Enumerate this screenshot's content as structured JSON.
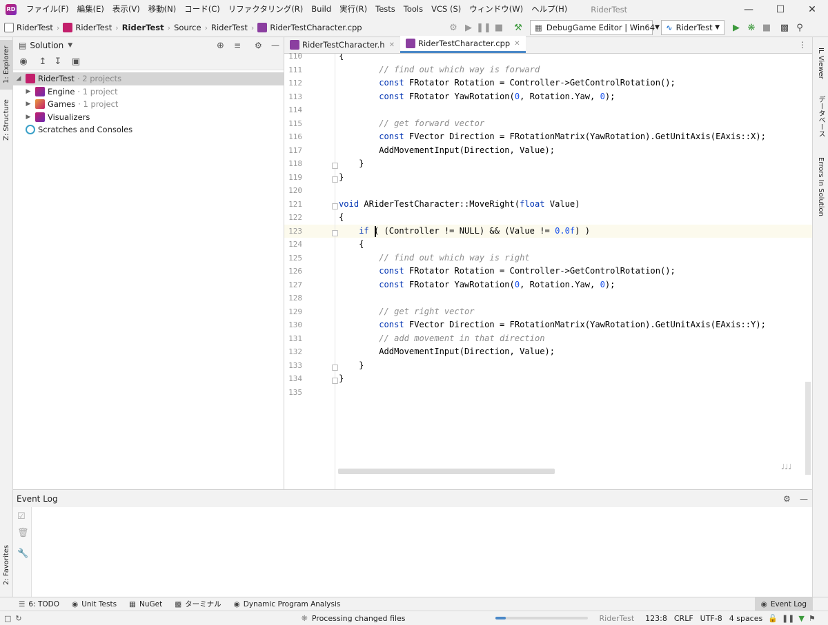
{
  "menu": {
    "items": [
      "ファイル(F)",
      "編集(E)",
      "表示(V)",
      "移動(N)",
      "コード(C)",
      "リファクタリング(R)",
      "Build",
      "実行(R)",
      "Tests",
      "Tools",
      "VCS (S)",
      "ウィンドウ(W)",
      "ヘルプ(H)"
    ],
    "app_title": "RiderTest"
  },
  "breadcrumb": {
    "items": [
      "RiderTest",
      "RiderTest",
      "RiderTest",
      "Source",
      "RiderTest",
      "RiderTestCharacter.cpp"
    ]
  },
  "toolbar": {
    "config": "DebugGame Editor | Win64",
    "project": "RiderTest"
  },
  "left_tools": {
    "explorer": "1: Explorer",
    "structure": "Z: Structure",
    "favorites": "2: Favorites"
  },
  "right_tools": {
    "il_viewer": "IL Viewer",
    "database": "データベース",
    "errors": "Errors In Solution"
  },
  "solution": {
    "title": "Solution",
    "tree": [
      {
        "label": "RiderTest",
        "note": "· 2 projects"
      },
      {
        "label": "Engine",
        "note": "· 1 project"
      },
      {
        "label": "Games",
        "note": "· 1 project"
      },
      {
        "label": "Visualizers",
        "note": ""
      },
      {
        "label": "Scratches and Consoles",
        "note": ""
      }
    ]
  },
  "editor": {
    "tabs": [
      {
        "label": "RiderTestCharacter.h"
      },
      {
        "label": "RiderTestCharacter.cpp"
      }
    ],
    "current_line": 123,
    "lines": [
      {
        "n": "110",
        "html": "{"
      },
      {
        "n": "111",
        "html": "        <span class='cm'>// find out which way is forward</span>"
      },
      {
        "n": "112",
        "html": "        <span class='kw'>const</span> FRotator Rotation = Controller->GetControlRotation();"
      },
      {
        "n": "113",
        "html": "        <span class='kw'>const</span> FRotator YawRotation(<span class='num'>0</span>, Rotation.Yaw, <span class='num'>0</span>);"
      },
      {
        "n": "114",
        "html": ""
      },
      {
        "n": "115",
        "html": "        <span class='cm'>// get forward vector</span>"
      },
      {
        "n": "116",
        "html": "        <span class='kw'>const</span> FVector Direction = FRotationMatrix(YawRotation).GetUnitAxis(EAxis::X);"
      },
      {
        "n": "117",
        "html": "        AddMovementInput(Direction, Value);"
      },
      {
        "n": "118",
        "html": "    }"
      },
      {
        "n": "119",
        "html": "}"
      },
      {
        "n": "120",
        "html": ""
      },
      {
        "n": "121",
        "html": "<span class='kw'>void</span> ARiderTestCharacter::MoveRight(<span class='kw'>float</span> Value)"
      },
      {
        "n": "122",
        "html": "{"
      },
      {
        "n": "123",
        "html": "    <span class='kw'>if</span> ( (Controller != NULL) && (Value != <span class='num'>0.0f</span>) )"
      },
      {
        "n": "124",
        "html": "    {"
      },
      {
        "n": "125",
        "html": "        <span class='cm'>// find out which way is right</span>"
      },
      {
        "n": "126",
        "html": "        <span class='kw'>const</span> FRotator Rotation = Controller->GetControlRotation();"
      },
      {
        "n": "127",
        "html": "        <span class='kw'>const</span> FRotator YawRotation(<span class='num'>0</span>, Rotation.Yaw, <span class='num'>0</span>);"
      },
      {
        "n": "128",
        "html": ""
      },
      {
        "n": "129",
        "html": "        <span class='cm'>// get right vector</span>"
      },
      {
        "n": "130",
        "html": "        <span class='kw'>const</span> FVector Direction = FRotationMatrix(YawRotation).GetUnitAxis(EAxis::Y);"
      },
      {
        "n": "131",
        "html": "        <span class='cm'>// add movement in that direction</span>"
      },
      {
        "n": "132",
        "html": "        AddMovementInput(Direction, Value);"
      },
      {
        "n": "133",
        "html": "    }"
      },
      {
        "n": "134",
        "html": "}"
      },
      {
        "n": "135",
        "html": ""
      }
    ]
  },
  "event_log": {
    "title": "Event Log"
  },
  "bottom_tabs": [
    "6: TODO",
    "Unit Tests",
    "NuGet",
    "ターミナル",
    "Dynamic Program Analysis"
  ],
  "bottom_right_tab": "Event Log",
  "status": {
    "task": "Processing changed files",
    "project": "RiderTest",
    "position": "123:8",
    "line_sep": "CRLF",
    "encoding": "UTF-8",
    "indent": "4 spaces"
  },
  "colors": {
    "accent": "#4a88c7",
    "run_green": "#3d9a3d",
    "rider_pink": "#c21f6b"
  }
}
